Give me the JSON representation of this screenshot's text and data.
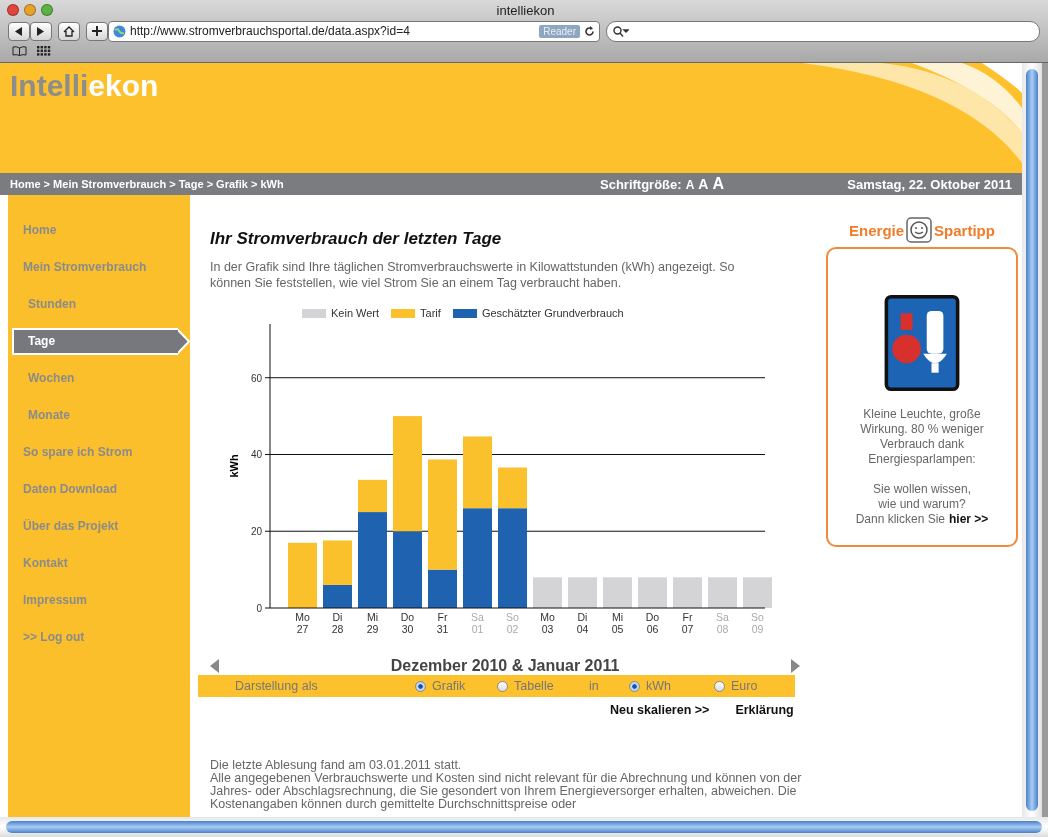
{
  "browser": {
    "title": "intelliekon",
    "url": "http://www.stromverbrauchsportal.de/data.aspx?id=4",
    "reader": "Reader"
  },
  "header": {
    "logo_first": "Intelli",
    "logo_second": "ekon"
  },
  "nav_bar": {
    "breadcrumb": "Home > Mein Stromverbrauch > Tage > Grafik > kWh",
    "font_size_label": "Schriftgröße:",
    "font_sizes": [
      "A",
      "A",
      "A"
    ],
    "date": "Samstag, 22. Oktober 2011"
  },
  "sidebar": {
    "items": [
      {
        "label": "Home",
        "selected": false
      },
      {
        "label": "Mein Stromverbrauch",
        "selected": false,
        "children": [
          {
            "label": "Stunden",
            "selected": false
          },
          {
            "label": "Tage",
            "selected": true
          },
          {
            "label": "Wochen",
            "selected": false
          },
          {
            "label": "Monate",
            "selected": false
          }
        ]
      },
      {
        "label": "So spare ich Strom",
        "selected": false
      },
      {
        "label": "Daten Download",
        "selected": false
      },
      {
        "label": "Über das Projekt",
        "selected": false
      },
      {
        "label": "Kontakt",
        "selected": false
      },
      {
        "label": "Impressum",
        "selected": false
      },
      {
        "label": ">> Log out",
        "selected": false
      }
    ]
  },
  "content": {
    "title": "Ihr Stromverbrauch der letzten Tage",
    "intro": "In der Grafik sind Ihre täglichen Stromverbrauchswerte in Kilowattstunden (kWh) angezeigt. So können Sie feststellen, wie viel Strom Sie an einem Tag verbraucht haben.",
    "muted_days": [
      false,
      false,
      false,
      false,
      false,
      true,
      true,
      false,
      false,
      false,
      false,
      false,
      true,
      true
    ],
    "chart_data": {
      "type": "bar",
      "stacked": true,
      "grid": true,
      "ylabel": "kWh",
      "ylim": [
        0,
        74
      ],
      "yticks": [
        0,
        20,
        40,
        60
      ],
      "categories": [
        "Mo 27",
        "Di 28",
        "Mi 29",
        "Do 30",
        "Fr 31",
        "Sa 01",
        "So 02",
        "Mo 03",
        "Di 04",
        "Mi 05",
        "Do 06",
        "Fr 07",
        "Sa 08",
        "So 09"
      ],
      "series": [
        {
          "name": "Kein Wert",
          "color": "#d4d4d6",
          "values": [
            null,
            null,
            null,
            null,
            null,
            null,
            null,
            8,
            8,
            8,
            8,
            8,
            8,
            8
          ]
        },
        {
          "name": "Tarif",
          "color": "#fbc12d",
          "values": [
            17,
            11.6,
            8.4,
            30,
            28.7,
            18.7,
            10.6,
            null,
            null,
            null,
            null,
            null,
            null,
            null
          ]
        },
        {
          "name": "Geschätzter Grundverbrauch",
          "color": "#1f63b0",
          "values": [
            0,
            6,
            25,
            20,
            10,
            26,
            26,
            null,
            null,
            null,
            null,
            null,
            null,
            null
          ]
        }
      ]
    },
    "period": "Dezember 2010 & Januar 2011",
    "display": {
      "label": "Darstellung als",
      "view_options": [
        {
          "label": "Grafik",
          "selected": true
        },
        {
          "label": "Tabelle",
          "selected": false
        }
      ],
      "unit_label": "in",
      "unit_options": [
        {
          "label": "kWh",
          "selected": true
        },
        {
          "label": "Euro",
          "selected": false
        }
      ]
    },
    "links": [
      "Neu skalieren >>",
      "Erklärung"
    ],
    "notes": [
      "Die letzte Ablesung fand am 03.01.2011 statt.",
      "Alle angegebenen Verbrauchswerte und Kosten sind nicht relevant für die Abrechnung und können von der Jahres- oder Abschlagsrechnung, die Sie gesondert von Ihrem Energieversorger erhalten, abweichen. Die Kostenangaben können durch gemittelte Durchschnittspreise oder"
    ]
  },
  "tip": {
    "heading_first": "Energie",
    "heading_second": "Spartipp",
    "text": "Kleine Leuchte, große Wirkung. 80 % weniger Verbrauch dank Energiesparlampen:",
    "question": "Sie wollen wissen, wie und warum?",
    "cta": "Dann klicken Sie",
    "link": "hier >>"
  }
}
